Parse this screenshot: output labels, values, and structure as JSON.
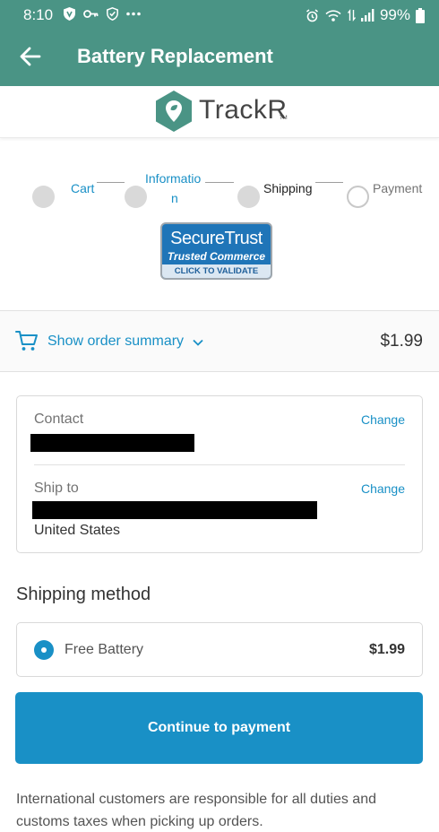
{
  "status_bar": {
    "time": "8:10",
    "battery_percent": "99%",
    "left_icons": [
      "shield-v-icon",
      "key-icon",
      "shield-check-icon",
      "more-dots-icon"
    ],
    "right_icons": [
      "alarm-icon",
      "wifi-icon",
      "data-arrows-icon",
      "signal-icon",
      "battery-icon"
    ]
  },
  "app_bar": {
    "title": "Battery Replacement",
    "background_color": "#4a9485"
  },
  "brand": {
    "name": "TrackR",
    "tm": "TM",
    "logo_color": "#4a9485"
  },
  "breadcrumb": {
    "steps": [
      {
        "label": "Cart",
        "state": "completed"
      },
      {
        "label_line1": "Informatio",
        "label_line2": "n",
        "state": "completed"
      },
      {
        "label": "Shipping",
        "state": "current"
      },
      {
        "label": "Payment",
        "state": "upcoming"
      }
    ]
  },
  "secure_badge": {
    "line1": "SecureTrust",
    "line2": "Trusted Commerce",
    "line3": "CLICK TO VALIDATE"
  },
  "order_summary": {
    "toggle_label": "Show order summary",
    "total": "$1.99",
    "accent_color": "#1990c6"
  },
  "review": {
    "contact_label": "Contact",
    "change_label": "Change",
    "ship_to_label": "Ship to",
    "country": "United States"
  },
  "shipping": {
    "heading": "Shipping method",
    "options": [
      {
        "name": "Free Battery",
        "price": "$1.99",
        "selected": true
      }
    ]
  },
  "continue_button": {
    "label": "Continue to payment",
    "color": "#1990c6"
  },
  "notice": "International customers are responsible for all duties and customs taxes when picking up orders."
}
